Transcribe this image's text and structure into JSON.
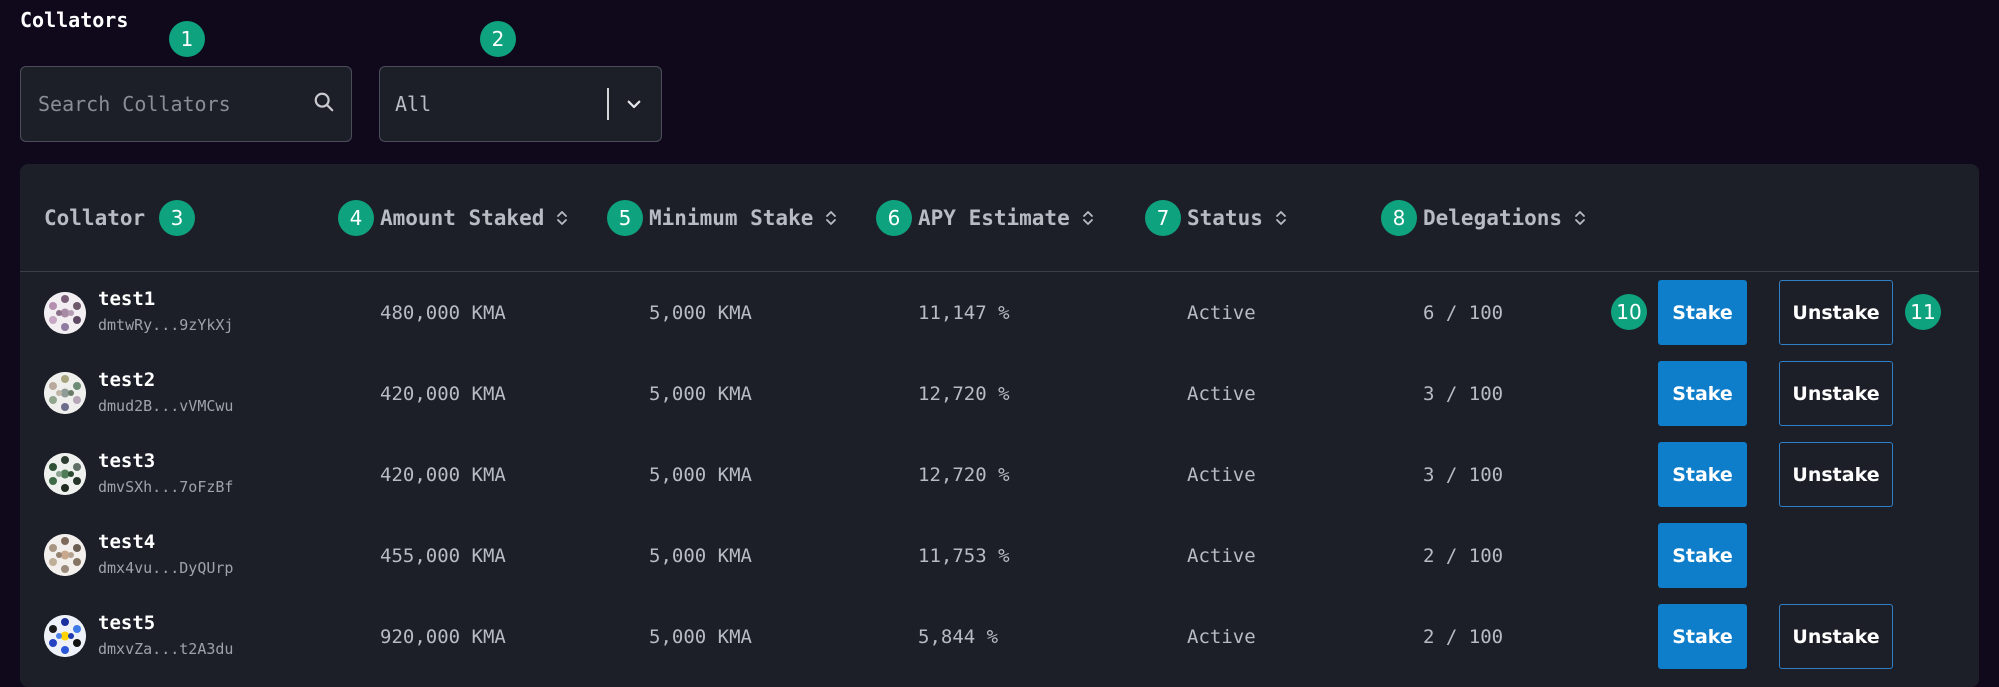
{
  "title": "Collators",
  "search": {
    "placeholder": "Search Collators",
    "icon": "search-icon"
  },
  "filter": {
    "selected": "All",
    "icon": "chevron-down-icon"
  },
  "annotations": [
    "1",
    "2",
    "3",
    "4",
    "5",
    "6",
    "7",
    "8",
    "10",
    "11"
  ],
  "table": {
    "columns": [
      "Collator",
      "Amount Staked",
      "Minimum Stake",
      "APY Estimate",
      "Status",
      "Delegations"
    ],
    "rows": [
      {
        "name": "test1",
        "address": "dmtwRy...9zYkXj",
        "amount_staked": "480,000 KMA",
        "minimum_stake": "5,000 KMA",
        "apy": "11,147 %",
        "status": "Active",
        "delegations": "6 / 100",
        "stake_label": "Stake",
        "unstake_label": "Unstake"
      },
      {
        "name": "test2",
        "address": "dmud2B...vVMCwu",
        "amount_staked": "420,000 KMA",
        "minimum_stake": "5,000 KMA",
        "apy": "12,720 %",
        "status": "Active",
        "delegations": "3 / 100",
        "stake_label": "Stake",
        "unstake_label": "Unstake"
      },
      {
        "name": "test3",
        "address": "dmvSXh...7oFzBf",
        "amount_staked": "420,000 KMA",
        "minimum_stake": "5,000 KMA",
        "apy": "12,720 %",
        "status": "Active",
        "delegations": "3 / 100",
        "stake_label": "Stake",
        "unstake_label": "Unstake"
      },
      {
        "name": "test4",
        "address": "dmx4vu...DyQUrp",
        "amount_staked": "455,000 KMA",
        "minimum_stake": "5,000 KMA",
        "apy": "11,753 %",
        "status": "Active",
        "delegations": "2 / 100",
        "stake_label": "Stake",
        "unstake_label": null
      },
      {
        "name": "test5",
        "address": "dmxvZa...t2A3du",
        "amount_staked": "920,000 KMA",
        "minimum_stake": "5,000 KMA",
        "apy": "5,844 %",
        "status": "Active",
        "delegations": "2 / 100",
        "stake_label": "Stake",
        "unstake_label": "Unstake"
      }
    ]
  },
  "colors": {
    "background": "#10091c",
    "panel": "#1d1f28",
    "annotation_badge": "#0ea37e",
    "stake_button": "#0e7ecb",
    "unstake_border": "#2f7fc6"
  }
}
